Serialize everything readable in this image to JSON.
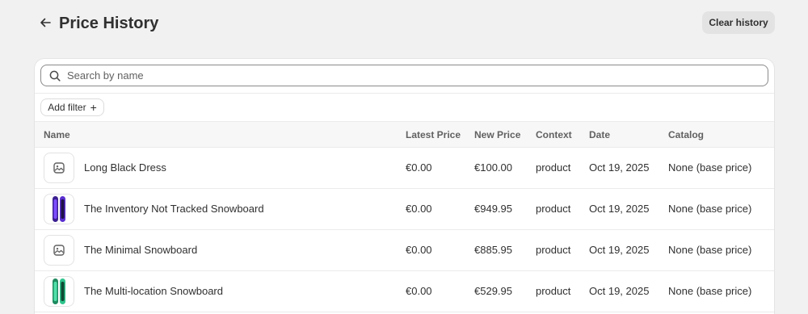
{
  "header": {
    "title": "Price History",
    "clear_label": "Clear history"
  },
  "search": {
    "placeholder": "Search by name",
    "value": ""
  },
  "filter": {
    "label": "Add filter",
    "plus": "+"
  },
  "table": {
    "columns": {
      "name": "Name",
      "latest": "Latest Price",
      "new": "New Price",
      "context": "Context",
      "date": "Date",
      "catalog": "Catalog"
    },
    "rows": [
      {
        "thumbnail": "image-placeholder-icon",
        "name": "Long Black Dress",
        "latest": "€0.00",
        "new": "€100.00",
        "context": "product",
        "date": "Oct 19, 2025",
        "catalog": "None (base price)"
      },
      {
        "thumbnail": "snowboard-purple-icon",
        "name": "The Inventory Not Tracked Snowboard",
        "latest": "€0.00",
        "new": "€949.95",
        "context": "product",
        "date": "Oct 19, 2025",
        "catalog": "None (base price)"
      },
      {
        "thumbnail": "image-placeholder-icon",
        "name": "The Minimal Snowboard",
        "latest": "€0.00",
        "new": "€885.95",
        "context": "product",
        "date": "Oct 19, 2025",
        "catalog": "None (base price)"
      },
      {
        "thumbnail": "snowboard-green-icon",
        "name": "The Multi-location Snowboard",
        "latest": "€0.00",
        "new": "€529.95",
        "context": "product",
        "date": "Oct 19, 2025",
        "catalog": "None (base price)"
      }
    ]
  },
  "colors": {
    "background": "#f1f1f1",
    "card": "#ffffff",
    "text": "#303030",
    "muted": "#616161",
    "button_secondary": "#e3e3e3",
    "snowboard_purple": "#6b3fd6",
    "snowboard_green": "#2fc48d"
  }
}
